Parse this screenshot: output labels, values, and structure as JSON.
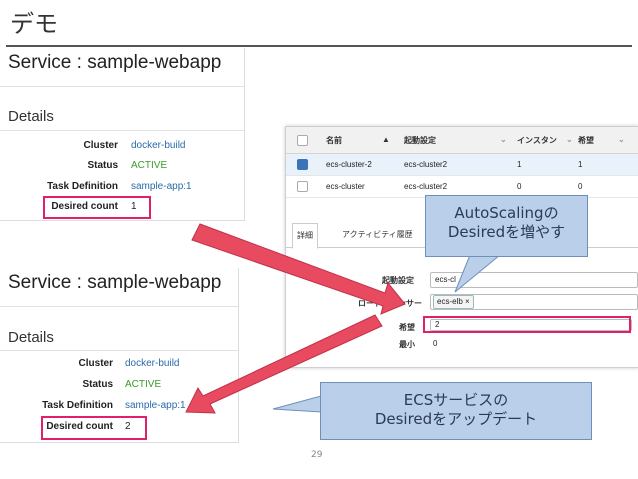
{
  "slide": {
    "title": "デモ",
    "page_number": "29"
  },
  "service_before": {
    "heading": "Service : sample-webapp",
    "details_label": "Details",
    "fields": [
      {
        "key": "Cluster",
        "value": "docker-build"
      },
      {
        "key": "Status",
        "value": "ACTIVE"
      },
      {
        "key": "Task Definition",
        "value": "sample-app:1"
      },
      {
        "key": "Desired count",
        "value": "1"
      }
    ]
  },
  "service_after": {
    "heading": "Service : sample-webapp",
    "details_label": "Details",
    "fields": [
      {
        "key": "Cluster",
        "value": "docker-build"
      },
      {
        "key": "Status",
        "value": "ACTIVE"
      },
      {
        "key": "Task Definition",
        "value": "sample-app:1"
      },
      {
        "key": "Desired count",
        "value": "2"
      }
    ]
  },
  "autoscaling_console": {
    "columns": [
      "名前",
      "起動設定",
      "インスタン",
      "希望"
    ],
    "rows": [
      {
        "name": "ecs-cluster-2",
        "launch_config": "ecs-cluster2",
        "instances": "1",
        "desired": "1",
        "selected": true
      },
      {
        "name": "ecs-cluster",
        "launch_config": "ecs-cluster2",
        "instances": "0",
        "desired": "0",
        "selected": false
      }
    ],
    "tabs": [
      "詳細",
      "アクティビティ履歴"
    ],
    "form": {
      "launch_label": "起動設定",
      "launch_value": "ecs-cl",
      "lb_label": "ロードバランサー",
      "lb_chip": "ecs-elb",
      "desired_label": "希望",
      "desired_value": "2",
      "min_label": "最小",
      "min_value": "0"
    }
  },
  "callouts": {
    "autoscaling": [
      "AutoScalingの",
      "Desiredを増やす"
    ],
    "ecs": [
      "ECSサービスの",
      "Desiredをアップデート"
    ]
  },
  "colors": {
    "highlight": "#e0206a",
    "arrow": "#e84a5f",
    "callout_fill": "#b9cfea",
    "link": "#2a6aab",
    "active": "#3a9a2a"
  }
}
